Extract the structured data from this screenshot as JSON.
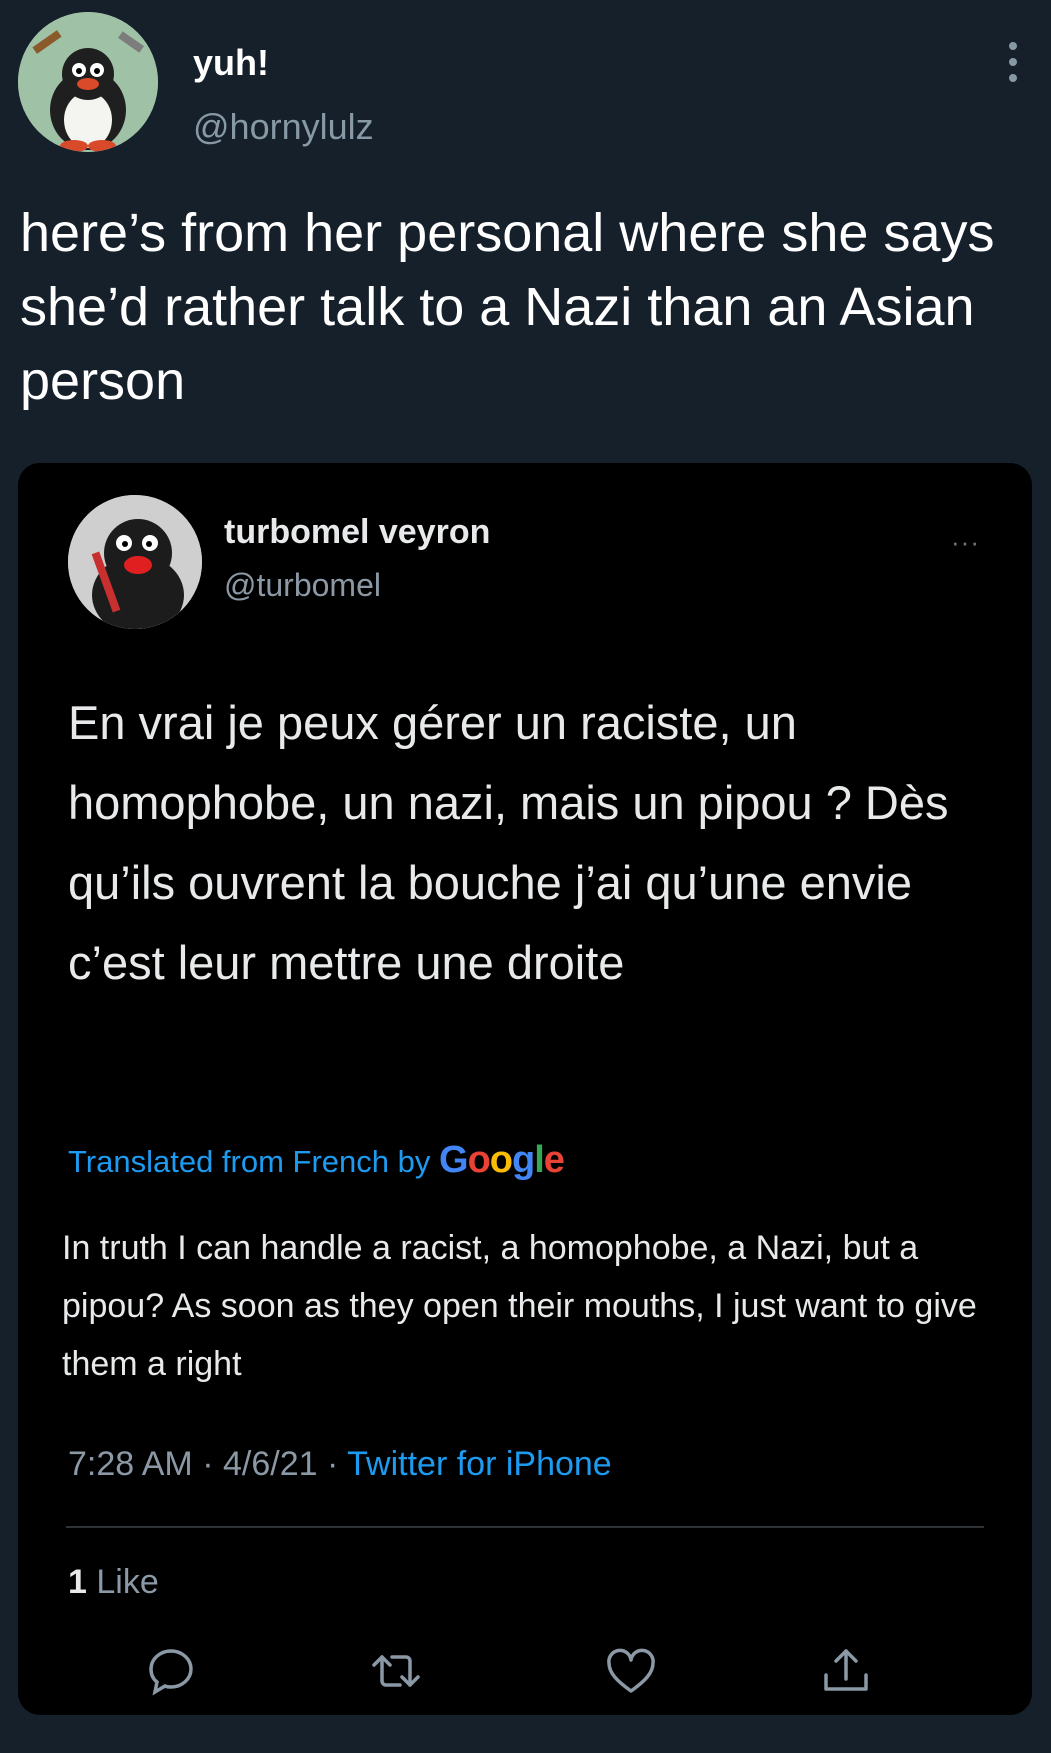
{
  "outer_tweet": {
    "display_name": "yuh!",
    "handle": "@hornylulz",
    "text": "here’s from her personal where she says she’d rather talk to a Nazi than an Asian person",
    "avatar_icon": "penguin-avatar-icon",
    "more_icon": "more-vertical-icon"
  },
  "quoted_tweet": {
    "display_name": "turbomel veyron",
    "handle": "@turbomel",
    "more_label": "···",
    "text": "En vrai je peux gérer un raciste, un homophobe, un nazi, mais un pipou ? Dès qu’ils ouvrent la bouche j’ai qu’une envie c’est leur mettre une droite",
    "translated_label": "Translated from French by",
    "google_letters": [
      "G",
      "o",
      "o",
      "g",
      "l",
      "e"
    ],
    "translation": "In truth I can handle a racist, a homophobe, a Nazi, but a pipou? As soon as they open their mouths, I just want to give them a right",
    "time": "7:28 AM",
    "date": "4/6/21",
    "separator": "·",
    "source": "Twitter for iPhone",
    "like_count": "1",
    "like_label": "Like",
    "actions": [
      "reply-icon",
      "retweet-icon",
      "like-icon",
      "share-icon"
    ],
    "avatar_icon": "penguin-avatar-icon"
  },
  "colors": {
    "outer_background": "#15202b",
    "card_background": "#000000",
    "link_blue": "#1d9bf0",
    "muted_text": "#8b98a5"
  }
}
